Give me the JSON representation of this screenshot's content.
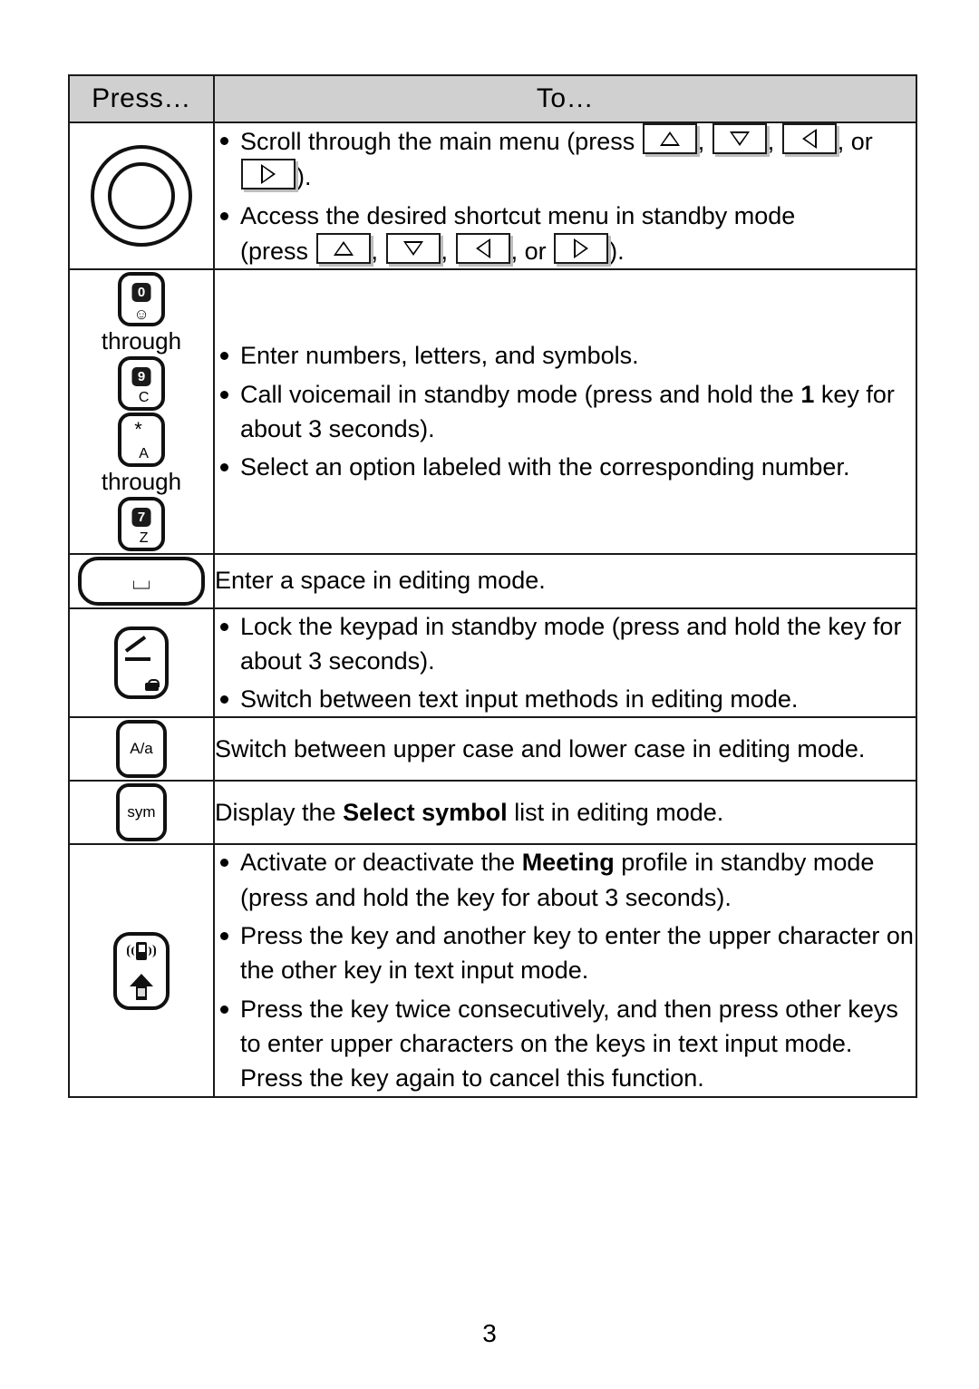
{
  "document": {
    "page_number": "3",
    "table": {
      "headers": {
        "press": "Press…",
        "to": "To…"
      },
      "rows": [
        {
          "key_name": "navigation-key",
          "key_label": "",
          "items": [
            "Scroll through the main menu (press {up}, {down}, {left}, or {right}).",
            "Access the desired shortcut menu in standby mode (press {up}, {down}, {left}, or {right})."
          ],
          "line1_a": "Scroll through the main menu (press",
          "line1_b": ", or",
          "line1_c": ").",
          "line2_a": "Access the desired shortcut menu in standby mode",
          "line2_b": "(press",
          "line2_c": ",",
          "line2_d": ", or",
          "line2_e": ")."
        },
        {
          "key_name": "numeric-keys",
          "through_label_1": "through",
          "through_label_2": "through",
          "key_0_num": "0",
          "key_0_sub": "☺",
          "key_9_num": "9",
          "key_9_sub": "C",
          "key_star_glyph": "*",
          "key_star_sub": "A",
          "key_7_num": "7",
          "key_7_sub": "Z",
          "items": [
            "Enter numbers, letters, and symbols.",
            "Call voicemail in standby mode (press and hold the 1 key for about 3 seconds).",
            "Select an option labeled with the corresponding number."
          ],
          "bullet2_a": "Call voicemail in standby mode (press and hold the",
          "bullet2_bold": "1",
          "bullet2_b": "key for about 3 seconds)."
        },
        {
          "key_name": "space-key",
          "key_glyph": "⌴",
          "text": "Enter a space in editing mode."
        },
        {
          "key_name": "lock-key",
          "items": [
            "Lock the keypad in standby mode (press and hold the key for about 3 seconds).",
            "Switch between text input methods in editing mode."
          ]
        },
        {
          "key_name": "case-key",
          "key_label": "A/a",
          "text": "Switch between upper case and lower case in editing mode."
        },
        {
          "key_name": "symbol-key",
          "key_label": "sym",
          "text_before": "Display the",
          "text_bold": "Select symbol",
          "text_after": "list in editing mode."
        },
        {
          "key_name": "shift-meeting-key",
          "items": [
            "Activate or deactivate the Meeting profile in standby mode (press and hold the key for about 3 seconds).",
            "Press the key and another key to enter the upper character on the other key in text input mode.",
            "Press the key twice consecutively, and then press other keys to enter upper characters on the keys in text input mode. Press the key again to cancel this function."
          ],
          "bullet1_a": "Activate or deactivate the",
          "bullet1_bold": "Meeting",
          "bullet1_b": "profile in standby mode (press and hold the key for about 3 seconds).",
          "bullet2": "Press the key and another key to enter the upper character on the other key in text input mode.",
          "bullet3": "Press the key twice consecutively, and then press other keys to enter upper characters on the keys in text input mode. Press the key again to cancel this function."
        }
      ]
    },
    "colors": {
      "header_background": "#d0d0d0",
      "border": "#1a1a1a",
      "text": "#000000",
      "page_background": "#ffffff"
    }
  }
}
